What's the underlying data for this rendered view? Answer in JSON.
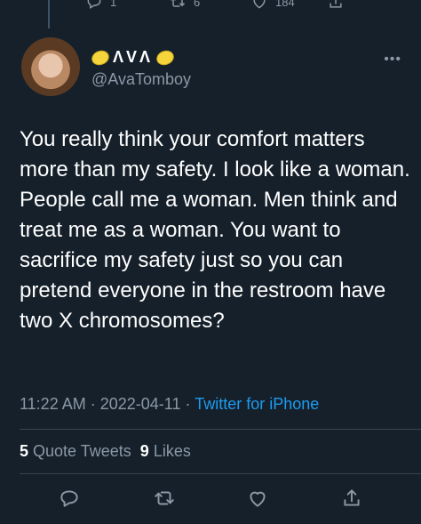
{
  "previous_tweet": {
    "reply_count": "1",
    "retweet_count": "6",
    "like_count": "184"
  },
  "author": {
    "display_name": "ΛVΛ",
    "handle": "@AvaTomboy"
  },
  "tweet": {
    "text": "You really think your comfort matters more than my safety.  I look like a woman.  People call me a woman.  Men think and treat me as a woman.  You want to sacrifice my safety just so you can pretend everyone in the restroom have two X chromosomes?",
    "time": "11:22 AM",
    "separator": "·",
    "date": "2022-04-11",
    "source": "Twitter for iPhone"
  },
  "stats": {
    "quote_count": "5",
    "quote_label": "Quote Tweets",
    "like_count": "9",
    "like_label": "Likes"
  },
  "icons": {
    "more": "more-icon",
    "reply": "reply-icon",
    "retweet": "retweet-icon",
    "like": "heart-icon",
    "share": "share-icon"
  },
  "colors": {
    "background": "#15202b",
    "secondary_text": "#8b98a5",
    "link": "#1d9bf0",
    "divider": "#38444d"
  }
}
